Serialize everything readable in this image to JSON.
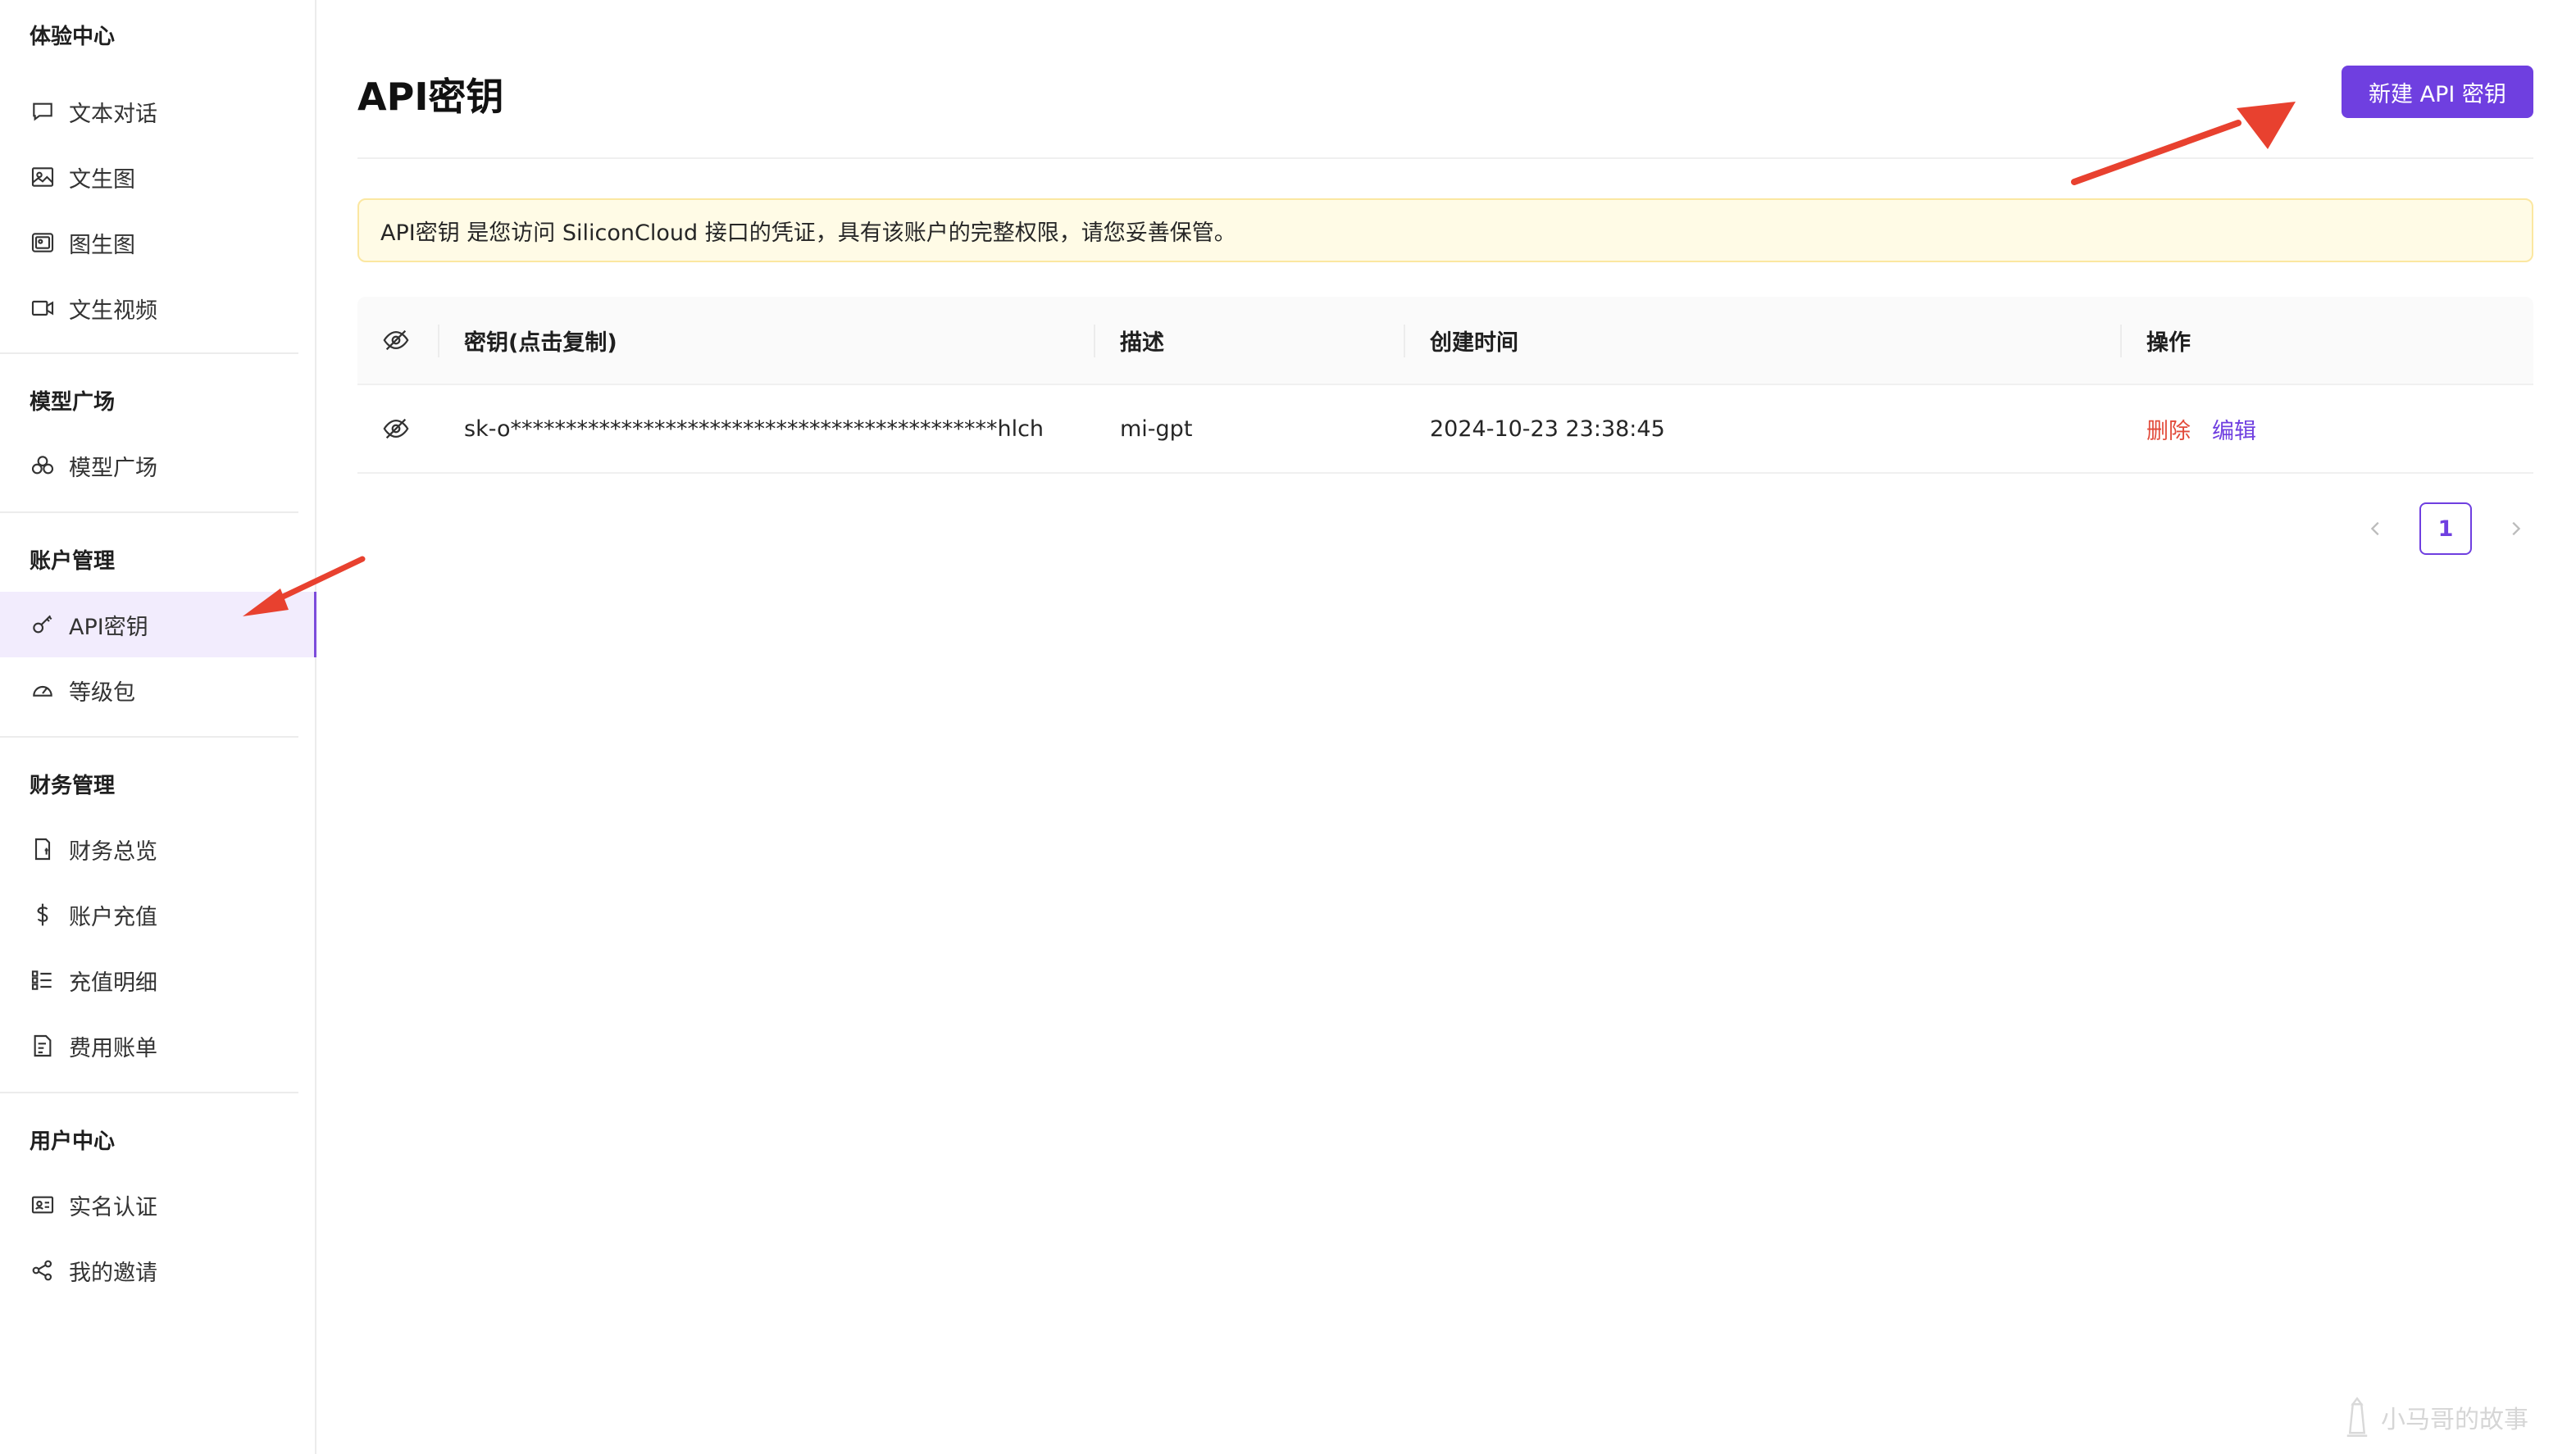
{
  "sidebar": {
    "sections": [
      {
        "title": "体验中心",
        "items": [
          {
            "label": "文本对话",
            "icon": "chat-icon"
          },
          {
            "label": "文生图",
            "icon": "image-icon"
          },
          {
            "label": "图生图",
            "icon": "images-icon"
          },
          {
            "label": "文生视频",
            "icon": "video-icon"
          }
        ]
      },
      {
        "title": "模型广场",
        "items": [
          {
            "label": "模型广场",
            "icon": "models-icon"
          }
        ]
      },
      {
        "title": "账户管理",
        "items": [
          {
            "label": "API密钥",
            "icon": "key-icon",
            "active": true
          },
          {
            "label": "等级包",
            "icon": "gauge-icon"
          }
        ]
      },
      {
        "title": "财务管理",
        "items": [
          {
            "label": "财务总览",
            "icon": "finance-icon"
          },
          {
            "label": "账户充值",
            "icon": "dollar-icon"
          },
          {
            "label": "充值明细",
            "icon": "list-icon"
          },
          {
            "label": "费用账单",
            "icon": "bill-icon"
          }
        ]
      },
      {
        "title": "用户中心",
        "items": [
          {
            "label": "实名认证",
            "icon": "id-card-icon"
          },
          {
            "label": "我的邀请",
            "icon": "share-icon"
          }
        ]
      }
    ]
  },
  "main": {
    "title": "API密钥",
    "new_button": "新建 API 密钥",
    "notice": "API密钥 是您访问 SiliconCloud 接口的凭证，具有该账户的完整权限，请您妥善保管。",
    "table": {
      "headers": {
        "key": "密钥(点击复制)",
        "desc": "描述",
        "time": "创建时间",
        "ops": "操作"
      },
      "rows": [
        {
          "key": "sk-o********************************************hlch",
          "desc": "mi-gpt",
          "time": "2024-10-23 23:38:45",
          "delete": "删除",
          "edit": "编辑"
        }
      ]
    },
    "pagination": {
      "current": "1"
    }
  },
  "watermark": "小马哥的故事",
  "colors": {
    "accent": "#6f3fe0",
    "danger": "#e24b3b",
    "notice_bg": "#fffbe6",
    "annotation": "#e8412f"
  }
}
